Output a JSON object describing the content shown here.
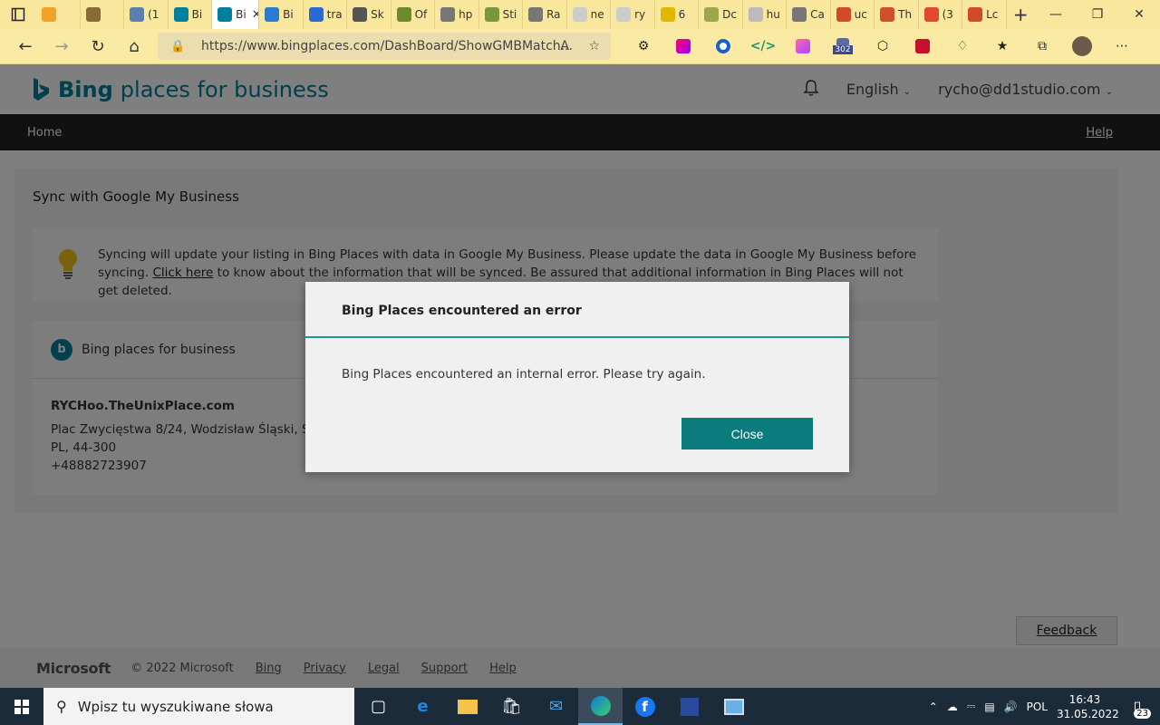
{
  "browser": {
    "tabs": [
      {
        "label": "",
        "color": "#f2a22a",
        "icon": "gmail-icon"
      },
      {
        "label": "",
        "color": "#8a6a3a",
        "icon": "cookie-icon"
      },
      {
        "label": "(1",
        "color": "#5b7fb0",
        "icon": "facebook-icon"
      },
      {
        "label": "Bi",
        "color": "#00809d",
        "icon": "bing-icon"
      },
      {
        "label": "Bi",
        "color": "#00809d",
        "icon": "bing-icon",
        "active": true
      },
      {
        "label": "Bi",
        "color": "#2a7bd0",
        "icon": "bing-maps-icon"
      },
      {
        "label": "tra",
        "color": "#2a6bd0",
        "icon": "search-icon"
      },
      {
        "label": "Sk",
        "color": "#555555",
        "icon": "keyboard-icon"
      },
      {
        "label": "Of",
        "color": "#6d8b2a",
        "icon": "app-icon"
      },
      {
        "label": "hp",
        "color": "#777777",
        "icon": "search-icon"
      },
      {
        "label": "Sti",
        "color": "#7a9a3a",
        "icon": "leaf-icon"
      },
      {
        "label": "Ra",
        "color": "#777777",
        "icon": "search-icon"
      },
      {
        "label": "ne",
        "color": "#cccccc",
        "icon": "page-icon"
      },
      {
        "label": "ry",
        "color": "#cccccc",
        "icon": "page-icon"
      },
      {
        "label": "6",
        "color": "#e0b800",
        "icon": "w-icon"
      },
      {
        "label": "Dc",
        "color": "#9aa84a",
        "icon": "app-icon"
      },
      {
        "label": "hu",
        "color": "#bbbbbb",
        "icon": "chart-icon"
      },
      {
        "label": "Ca",
        "color": "#777777",
        "icon": "app-icon"
      },
      {
        "label": "uc",
        "color": "#d04a2a",
        "icon": "pdf-icon"
      },
      {
        "label": "Th",
        "color": "#d0502a",
        "icon": "shield-icon"
      },
      {
        "label": "(3",
        "color": "#e04a2a",
        "icon": "youtube-icon"
      },
      {
        "label": "Lc",
        "color": "#d04a2a",
        "icon": "pdf-icon"
      }
    ],
    "url": "https://www.bingplaces.com/DashBoard/ShowGMBMatch...",
    "extension_badge": "302"
  },
  "header": {
    "logo_brand": "Bing",
    "logo_rest": "places for business",
    "language": "English",
    "account": "rycho@dd1studio.com"
  },
  "nav": {
    "home": "Home",
    "help": "Help"
  },
  "main": {
    "title": "Sync with Google My Business",
    "info_text": "Syncing will update your listing in Bing Places with data in Google My Business. Please update the data in Google My Business before syncing. ",
    "info_link": "Click here",
    "info_text2": " to know about the information that will be synced. Be assured that additional information in Bing Places will not get deleted.",
    "listing_source": "Bing places for business",
    "business_name": "RYCHoo.TheUnixPlace.com",
    "address_line1": "Plac Zwycięstwa 8/24, Wodzisław Śląski, ŚLĄSKIE",
    "address_line2": "PL, 44-300",
    "phone": "+48882723907"
  },
  "feedback": "Feedback",
  "footer": {
    "brand": "Microsoft",
    "copyright": "© 2022 Microsoft",
    "links": [
      "Bing",
      "Privacy",
      "Legal",
      "Support",
      "Help"
    ]
  },
  "dialog": {
    "title": "Bing Places encountered an error",
    "message": "Bing Places encountered an internal error. Please try again.",
    "close_label": "Close"
  },
  "taskbar": {
    "search_placeholder": "Wpisz tu wyszukiwane słowa",
    "language": "POL",
    "time": "16:43",
    "date": "31.05.2022",
    "notifications": "23"
  }
}
